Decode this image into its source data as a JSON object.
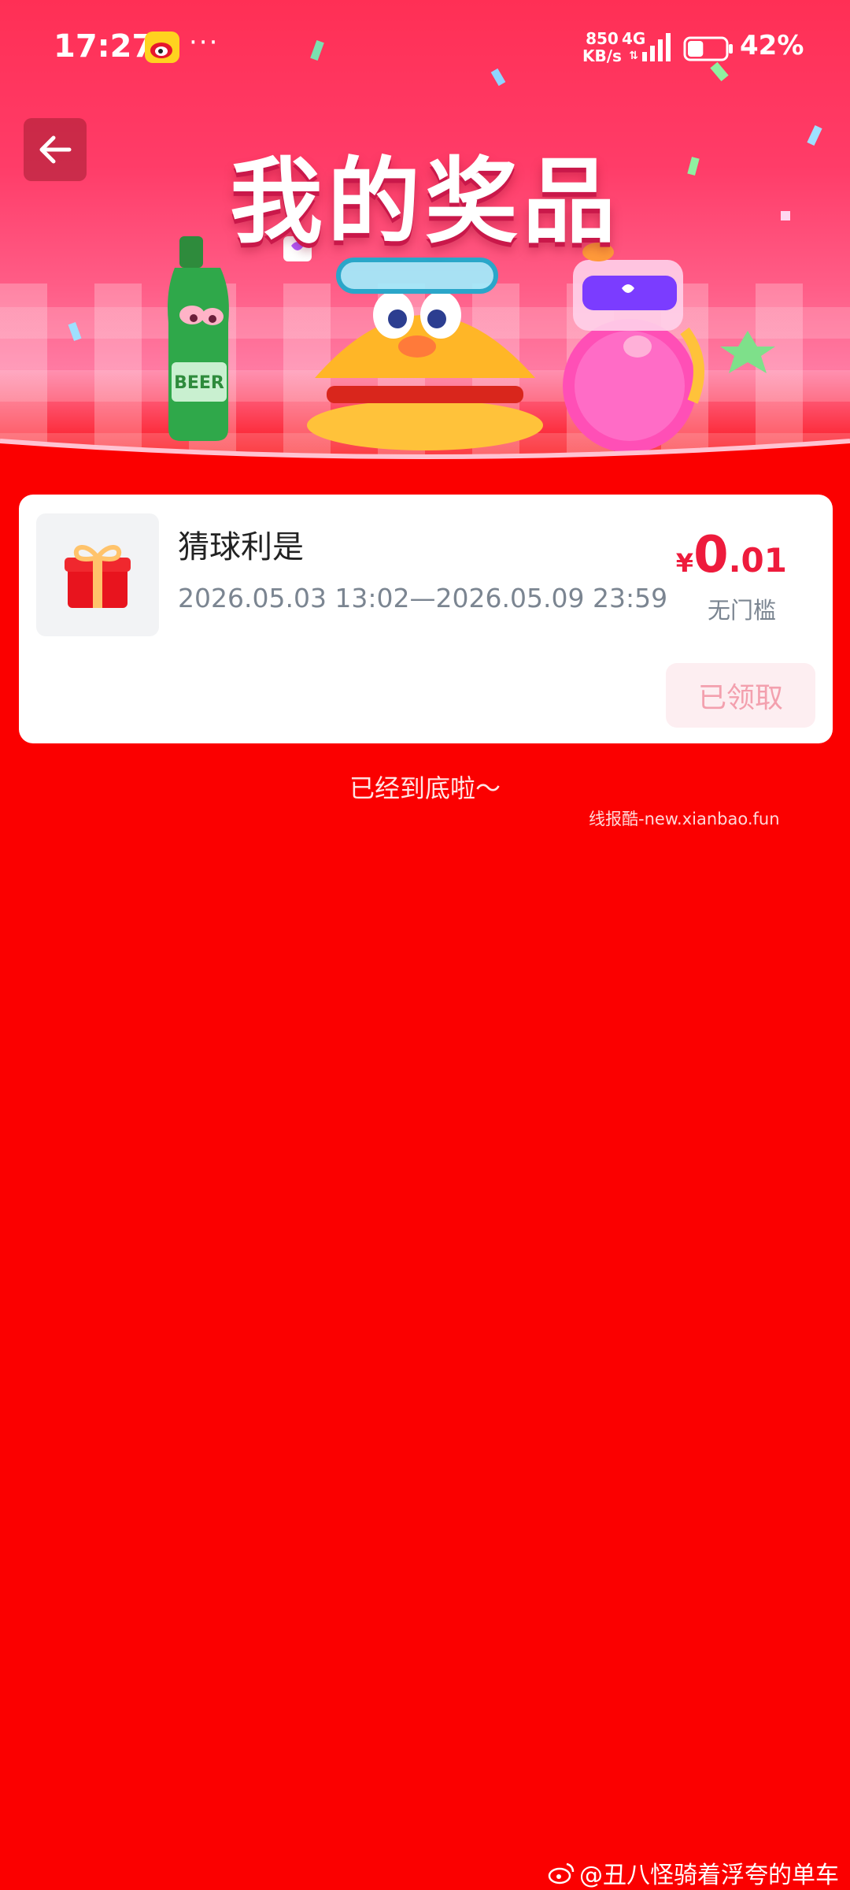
{
  "status_bar": {
    "time": "17:27",
    "more": "···",
    "net_speed_value": "850",
    "net_speed_unit": "KB/s",
    "network_type": "4G",
    "battery_percent": "42%",
    "battery_level": 0.42
  },
  "header": {
    "title": "我的奖品",
    "back_icon": "arrow-left-icon"
  },
  "prize_list": {
    "items": [
      {
        "name": "猜球利是",
        "validity": "2026.05.03 13:02—2026.05.09 23:59",
        "currency": "¥",
        "amount_int": "0",
        "amount_dec": ".01",
        "threshold": "无门槛",
        "status": "已领取",
        "icon": "gift-box-icon"
      }
    ],
    "end_text": "已经到底啦～"
  },
  "watermark": "线报酷-new.xianbao.fun",
  "credit": "@丑八怪骑着浮夸的单车",
  "colors": {
    "page_background": "#fb0000",
    "accent_price": "#ee1b3c",
    "claimed_button_bg": "#fdeef1",
    "claimed_button_text": "#f3a0ae"
  }
}
